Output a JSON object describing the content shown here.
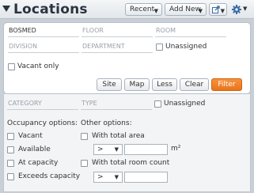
{
  "header": {
    "title": "Locations",
    "recent_label": "Recent",
    "add_new_label": "Add New"
  },
  "filters": {
    "row1": [
      "BOSMED",
      "FLOOR",
      "ROOM"
    ],
    "row2": [
      "DIVISION",
      "DEPARTMENT"
    ],
    "unassigned_label": "Unassigned",
    "vacant_only_label": "Vacant only"
  },
  "buttons": {
    "site": "Site",
    "map": "Map",
    "less": "Less",
    "clear": "Clear",
    "filter": "Filter"
  },
  "advanced": {
    "category_placeholder": "CATEGORY",
    "type_placeholder": "TYPE",
    "unassigned_label": "Unassigned",
    "occupancy_heading": "Occupancy options:",
    "occupancy": [
      "Vacant",
      "Available",
      "At capacity",
      "Exceeds capacity"
    ],
    "other_heading": "Other options:",
    "total_area_label": "With total area",
    "area_operator": ">",
    "area_unit": "m²",
    "total_room_label": "With total room count",
    "room_operator": ">"
  },
  "colors": {
    "accent": "#f08224",
    "title": "#2b3440"
  }
}
